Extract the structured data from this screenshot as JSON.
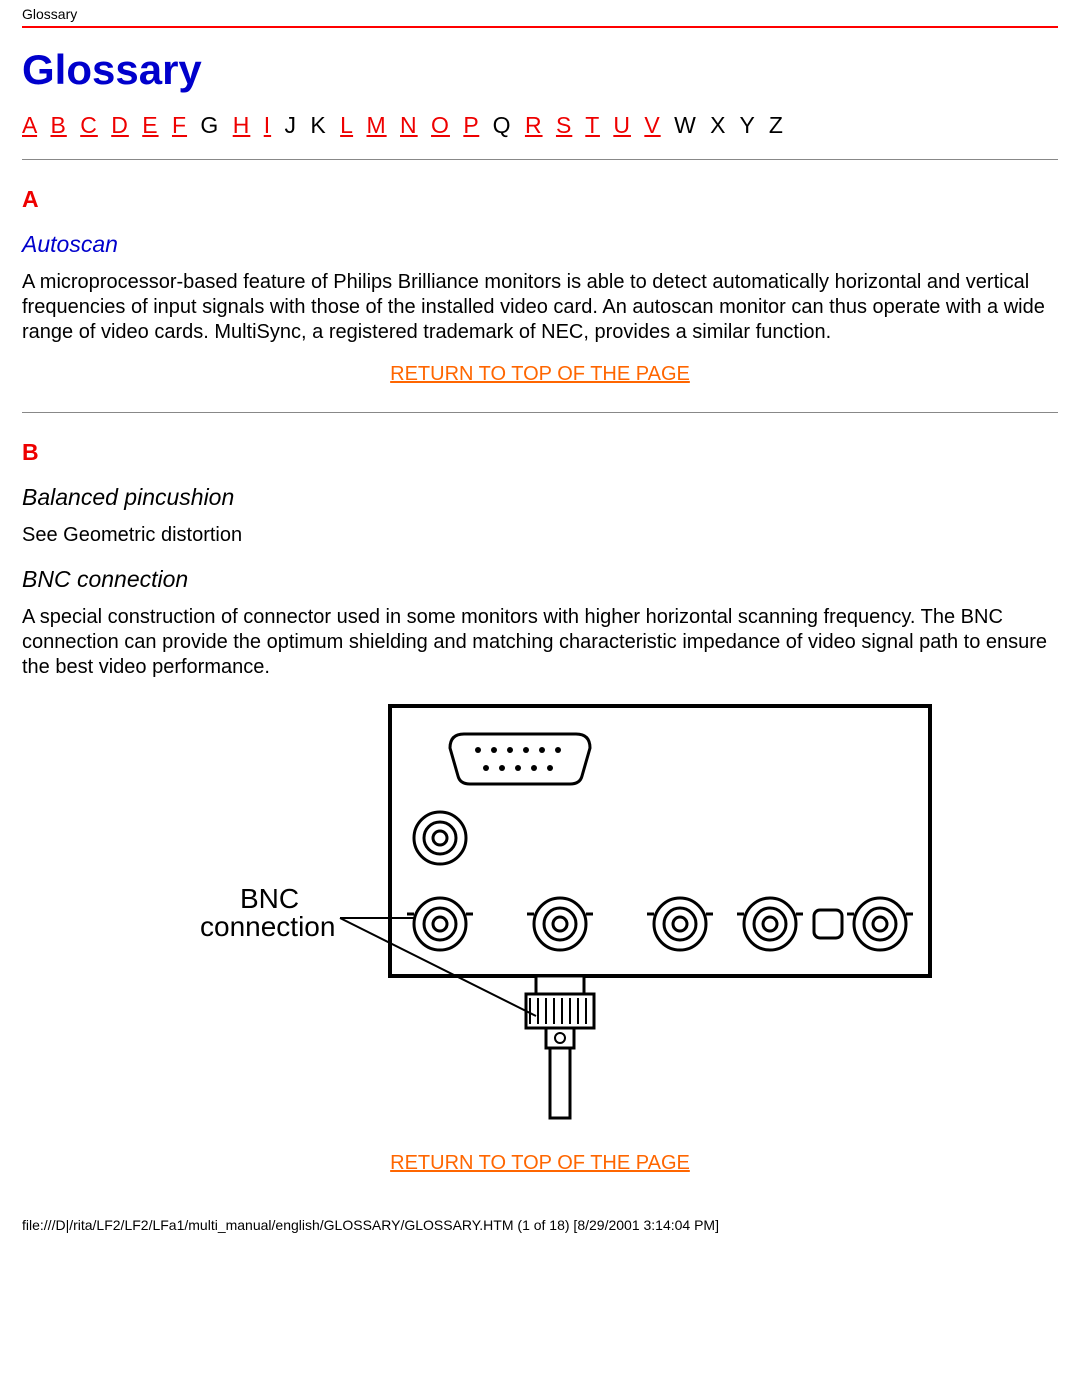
{
  "header_label": "Glossary",
  "page_title": "Glossary",
  "alpha_index": [
    {
      "t": "A",
      "link": true
    },
    {
      "t": "B",
      "link": true
    },
    {
      "t": "C",
      "link": true
    },
    {
      "t": "D",
      "link": true
    },
    {
      "t": "E",
      "link": true
    },
    {
      "t": "F",
      "link": true
    },
    {
      "t": "G",
      "link": false
    },
    {
      "t": "H",
      "link": true
    },
    {
      "t": "I",
      "link": true
    },
    {
      "t": "J",
      "link": false
    },
    {
      "t": "K",
      "link": false
    },
    {
      "t": "L",
      "link": true
    },
    {
      "t": "M",
      "link": true
    },
    {
      "t": "N",
      "link": true
    },
    {
      "t": "O",
      "link": true
    },
    {
      "t": "P",
      "link": true
    },
    {
      "t": "Q",
      "link": false
    },
    {
      "t": "R",
      "link": true
    },
    {
      "t": "S",
      "link": true
    },
    {
      "t": "T",
      "link": true
    },
    {
      "t": "U",
      "link": true
    },
    {
      "t": "V",
      "link": true
    },
    {
      "t": "W",
      "link": false
    },
    {
      "t": "X",
      "link": false
    },
    {
      "t": "Y",
      "link": false
    },
    {
      "t": "Z",
      "link": false
    }
  ],
  "sections": {
    "A": {
      "letter": "A",
      "terms": {
        "autoscan": {
          "title": "Autoscan",
          "body": "A microprocessor-based feature of Philips Brilliance monitors is able to detect automatically horizontal and vertical frequencies of input signals with those of the installed video card. An autoscan monitor can thus operate with a wide range of video cards. MultiSync, a registered trademark of NEC, provides a similar function."
        }
      }
    },
    "B": {
      "letter": "B",
      "terms": {
        "balanced_pincushion": {
          "title": "Balanced pincushion",
          "body": "See Geometric distortion"
        },
        "bnc_connection": {
          "title": "BNC connection",
          "body": "A special construction of connector used in some monitors with higher horizontal scanning frequency. The BNC connection can provide the optimum shielding and matching characteristic impedance of video signal path to ensure the best video performance."
        }
      }
    }
  },
  "diagram": {
    "label_line1": "BNC",
    "label_line2": "connection"
  },
  "return_link_text": "RETURN TO TOP OF THE PAGE",
  "footer_text": "file:///D|/rita/LF2/LF2/LFa1/multi_manual/english/GLOSSARY/GLOSSARY.HTM (1 of 18) [8/29/2001 3:14:04 PM]"
}
